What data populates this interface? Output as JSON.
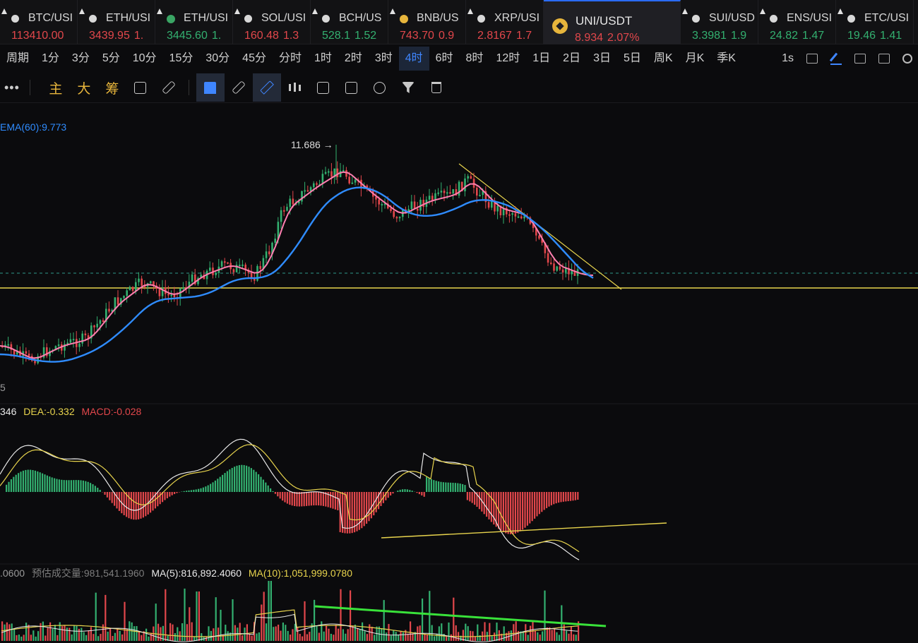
{
  "tabs": [
    {
      "symbol": "BTC/USI",
      "price": "113410.00",
      "change": "",
      "trend": "down",
      "icon": "white"
    },
    {
      "symbol": "ETH/USI",
      "price": "3439.95",
      "change": "1.",
      "trend": "down",
      "icon": "white"
    },
    {
      "symbol": "ETH/USI",
      "price": "3445.60",
      "change": "1.",
      "trend": "up",
      "icon": "green"
    },
    {
      "symbol": "SOL/USI",
      "price": "160.48",
      "change": "1.3",
      "trend": "down",
      "icon": "white"
    },
    {
      "symbol": "BCH/US",
      "price": "528.1",
      "change": "1.52",
      "trend": "up",
      "icon": "white"
    },
    {
      "symbol": "BNB/US",
      "price": "743.70",
      "change": "0.9",
      "trend": "down",
      "icon": "yellow"
    },
    {
      "symbol": "XRP/USI",
      "price": "2.8167",
      "change": "1.7",
      "trend": "down",
      "icon": "white"
    },
    {
      "symbol": "UNI/USDT",
      "price": "8.934",
      "change": "2.07%",
      "trend": "down",
      "icon": "bnb",
      "active": true
    },
    {
      "symbol": "SUI/USD",
      "price": "3.3981",
      "change": "1.9",
      "trend": "up",
      "icon": "white"
    },
    {
      "symbol": "ENS/USI",
      "price": "24.82",
      "change": "1.47",
      "trend": "up",
      "icon": "white"
    },
    {
      "symbol": "ETC/USI",
      "price": "19.46",
      "change": "1.41",
      "trend": "up",
      "icon": "white"
    }
  ],
  "periods": [
    "周期",
    "1分",
    "3分",
    "5分",
    "10分",
    "15分",
    "30分",
    "45分",
    "分时",
    "1时",
    "2时",
    "3时",
    "4时",
    "6时",
    "8时",
    "12时",
    "1日",
    "2日",
    "3日",
    "5日",
    "周K",
    "月K",
    "季K"
  ],
  "active_period": "4时",
  "period_right": {
    "second_label": "1s"
  },
  "toolbar": {
    "dots": "•••",
    "main": "主",
    "big": "大",
    "chips": "筹"
  },
  "chart": {
    "ema_label": "EMA(60):9.773",
    "high_marker": "11.686 →",
    "left_tick": "5",
    "macd": {
      "dif_part": "346",
      "dea": "DEA:-0.332",
      "macd": "MACD:-0.028"
    },
    "volume": {
      "vol_part": ".0600",
      "est_label": "预估成交量:981,541.1960",
      "ma5": "MA(5):816,892.4060",
      "ma10": "MA(10):1,051,999.0780"
    },
    "colors": {
      "up": "#33b070",
      "down": "#e2474b",
      "ema_fast": "#ff7fb0",
      "ema_slow": "#2f8cff",
      "trend": "#e8d44d",
      "green_line": "#39e23a",
      "dif": "#e8e8e8",
      "dea": "#e8d44d"
    }
  }
}
